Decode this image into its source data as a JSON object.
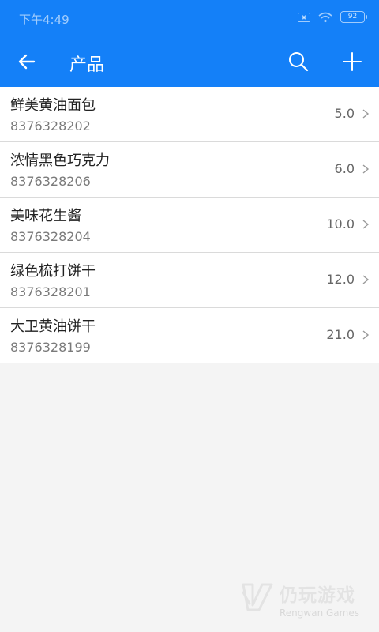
{
  "status_bar": {
    "time": "下午4:49",
    "battery": "92"
  },
  "app_bar": {
    "title": "产品",
    "back_icon": "arrow-left-icon",
    "search_icon": "search-icon",
    "add_icon": "plus-icon",
    "color": "#1480f8"
  },
  "products": [
    {
      "name": "鲜美黄油面包",
      "code": "8376328202",
      "price": "5.0"
    },
    {
      "name": "浓情黑色巧克力",
      "code": "8376328206",
      "price": "6.0"
    },
    {
      "name": "美味花生酱",
      "code": "8376328204",
      "price": "10.0"
    },
    {
      "name": "绿色梳打饼干",
      "code": "8376328201",
      "price": "12.0"
    },
    {
      "name": "大卫黄油饼干",
      "code": "8376328199",
      "price": "21.0"
    }
  ],
  "watermark": {
    "cn": "仍玩游戏",
    "en": "Rengwan Games"
  }
}
